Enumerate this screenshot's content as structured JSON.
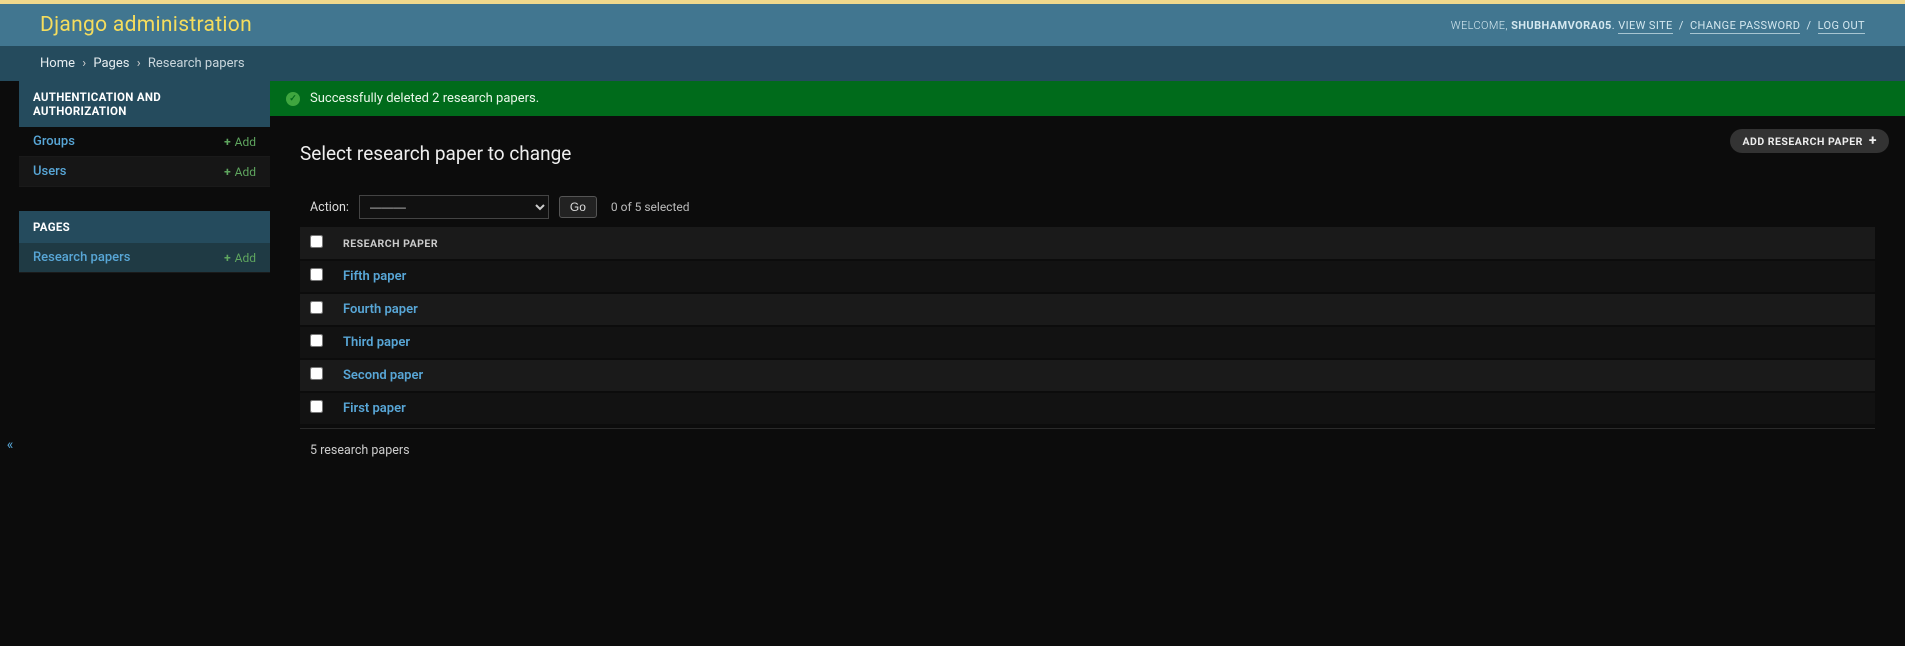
{
  "header": {
    "site_title": "Django administration",
    "welcome": "WELCOME,",
    "username": "SHUBHAMVORA05",
    "view_site": "VIEW SITE",
    "change_password": "CHANGE PASSWORD",
    "log_out": "LOG OUT",
    "sep": "/"
  },
  "breadcrumbs": {
    "home": "Home",
    "pages": "Pages",
    "current": "Research papers",
    "sep": "›"
  },
  "sidebar": {
    "auth": {
      "title": "AUTHENTICATION AND AUTHORIZATION",
      "items": [
        {
          "label": "Groups",
          "add": "Add"
        },
        {
          "label": "Users",
          "add": "Add"
        }
      ]
    },
    "pages": {
      "title": "PAGES",
      "items": [
        {
          "label": "Research papers",
          "add": "Add",
          "current": true
        }
      ]
    },
    "toggle_glyph": "«"
  },
  "message": {
    "text": "Successfully deleted 2 research papers."
  },
  "content": {
    "page_title": "Select research paper to change",
    "add_button": "ADD RESEARCH PAPER",
    "actions": {
      "label": "Action:",
      "option": "———",
      "go": "Go",
      "counter": "0 of 5 selected"
    },
    "table": {
      "header": "RESEARCH PAPER",
      "rows": [
        {
          "title": "Fifth paper"
        },
        {
          "title": "Fourth paper"
        },
        {
          "title": "Third paper"
        },
        {
          "title": "Second paper"
        },
        {
          "title": "First paper"
        }
      ]
    },
    "paginator": "5 research papers"
  }
}
